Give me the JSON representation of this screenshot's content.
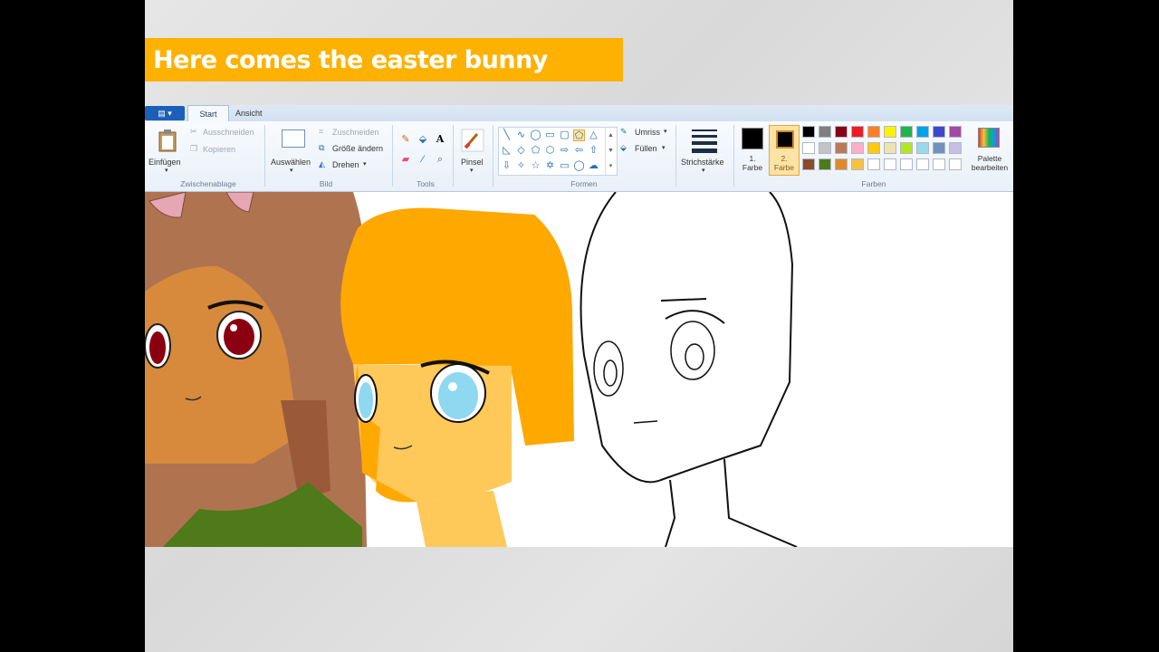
{
  "banner": {
    "title": "Here comes the easter bunny"
  },
  "tabs": {
    "start": "Start",
    "ansicht": "Ansicht"
  },
  "clipboard": {
    "paste": "Einfügen",
    "cut": "Ausschneiden",
    "copy": "Kopieren",
    "group": "Zwischenablage"
  },
  "image": {
    "select": "Auswählen",
    "crop": "Zuschneiden",
    "resize": "Größe ändern",
    "rotate": "Drehen",
    "group": "Bild"
  },
  "tools": {
    "group": "Tools",
    "text_tool": "A"
  },
  "brushes": {
    "label": "Pinsel"
  },
  "shapes": {
    "outline": "Umriss",
    "fill": "Füllen",
    "group": "Formen"
  },
  "size": {
    "label": "Strichstärke"
  },
  "colors": {
    "color1": "1. Farbe",
    "color2": "2. Farbe",
    "edit_palette": "Palette bearbeiten",
    "group": "Farben",
    "color1_value": "#000000",
    "color2_value": "#000000",
    "palette_row1": [
      "#000000",
      "#7f7f7f",
      "#880015",
      "#ed1c24",
      "#ff7f27",
      "#fff200",
      "#22b14c",
      "#00a2e8",
      "#3f48cc",
      "#a349a4"
    ],
    "palette_row2": [
      "#ffffff",
      "#c3c3c3",
      "#b97a57",
      "#ffaec9",
      "#ffc90e",
      "#efe4b0",
      "#b5e61d",
      "#99d9ea",
      "#7092be",
      "#c8bfe7"
    ],
    "palette_row3": [
      "#8b4a2b",
      "#4e7a1a",
      "#e08a2c",
      "#f5c245",
      "#ffffff",
      "#ffffff",
      "#ffffff",
      "#ffffff",
      "#ffffff",
      "#ffffff"
    ]
  }
}
